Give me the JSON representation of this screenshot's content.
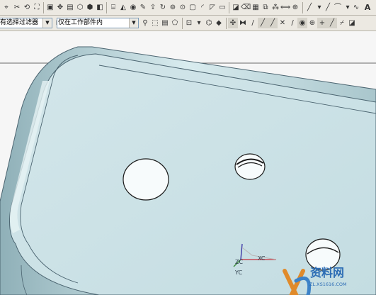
{
  "toolbar_top": {
    "icons": [
      "snap-point-icon",
      "attach-icon",
      "rotate-view-icon",
      "fit-icon",
      "zoom-icon",
      "pan-icon",
      "layer-icon",
      "shade-icon",
      "wireframe-icon",
      "block-icon",
      "cylinder-icon",
      "cone-icon",
      "sphere-icon",
      "sketch-icon",
      "extrude-icon",
      "revolve-icon",
      "hole-icon",
      "boss-icon",
      "pocket-icon",
      "blend-icon",
      "chamfer-icon",
      "shell-icon",
      "draft-icon",
      "trim-icon",
      "thicken-icon",
      "offset-icon",
      "pattern-icon",
      "mirror-icon",
      "unite-icon",
      "subtract-icon",
      "intersect-icon",
      "curve-icon",
      "line-icon",
      "arc-icon",
      "spline-icon",
      "text-icon"
    ],
    "dropdown_arrow": "▾",
    "text_label": "A"
  },
  "toolbar_filter": {
    "type_filter_value": "有选择过滤器",
    "scope_filter_value": "仅在工作部件内"
  },
  "toolbar_bottom": {
    "icons": [
      "plus-icon",
      "line-tool-icon",
      "arc-tool-icon",
      "circle-tool-icon",
      "fillet-tool-icon",
      "offset-curve-icon",
      "trim-curve-icon",
      "point-tool-icon",
      "constraint-icon",
      "dimension-icon",
      "selection-icon",
      "rectangle-icon",
      "polygon-icon",
      "ellipse-icon",
      "mirror-curve-icon",
      "snap-end-icon",
      "snap-mid-icon",
      "snap-center-icon",
      "snap-quadrant-icon",
      "snap-intersect-icon",
      "snap-tangent-icon",
      "snap-on-curve-icon"
    ]
  },
  "viewport": {
    "background": "#f6f6f6",
    "part_color": "#c9e0e4",
    "part_edge_color": "#4b6470",
    "wcs": {
      "zc": "ZC",
      "xc": "XC",
      "yc": "YC"
    }
  },
  "watermark": {
    "title": "资料网",
    "url": "ZL.XS1616.COM"
  }
}
